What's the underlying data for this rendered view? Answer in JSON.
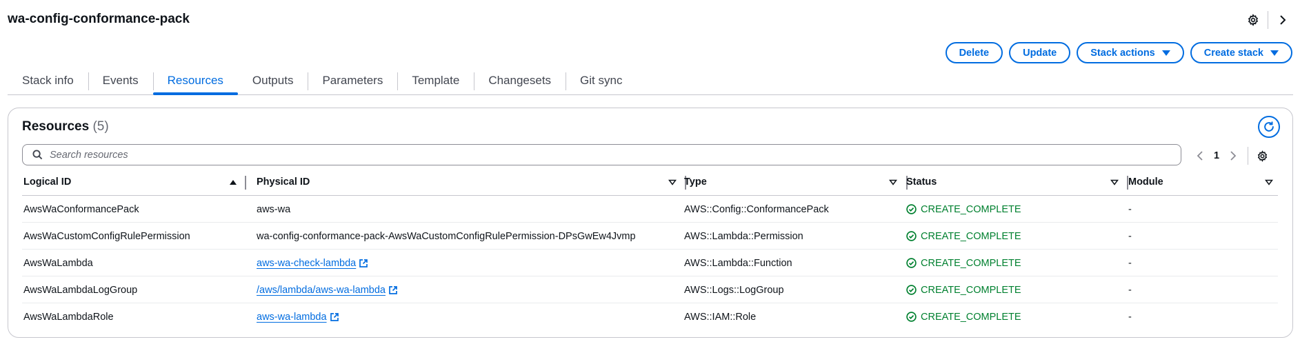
{
  "page": {
    "title": "wa-config-conformance-pack"
  },
  "top_icons": [
    "gear-icon",
    "chevron-right-icon"
  ],
  "actions": {
    "delete_label": "Delete",
    "update_label": "Update",
    "stack_actions_label": "Stack actions",
    "create_stack_label": "Create stack"
  },
  "tabs": [
    {
      "label": "Stack info"
    },
    {
      "label": "Events"
    },
    {
      "label": "Resources",
      "active": true
    },
    {
      "label": "Outputs"
    },
    {
      "label": "Parameters"
    },
    {
      "label": "Template"
    },
    {
      "label": "Changesets"
    },
    {
      "label": "Git sync"
    }
  ],
  "resources": {
    "title": "Resources",
    "count": "(5)",
    "search_placeholder": "Search resources",
    "page_number": "1",
    "columns": [
      "Logical ID",
      "Physical ID",
      "Type",
      "Status",
      "Module"
    ],
    "rows": [
      {
        "logical_id": "AwsWaConformancePack",
        "physical_id": "aws-wa",
        "physical_link": false,
        "type": "AWS::Config::ConformancePack",
        "status": "CREATE_COMPLETE",
        "module": "-"
      },
      {
        "logical_id": "AwsWaCustomConfigRulePermission",
        "physical_id": "wa-config-conformance-pack-AwsWaCustomConfigRulePermission-DPsGwEw4Jvmp",
        "physical_link": false,
        "type": "AWS::Lambda::Permission",
        "status": "CREATE_COMPLETE",
        "module": "-"
      },
      {
        "logical_id": "AwsWaLambda",
        "physical_id": "aws-wa-check-lambda",
        "physical_link": true,
        "type": "AWS::Lambda::Function",
        "status": "CREATE_COMPLETE",
        "module": "-"
      },
      {
        "logical_id": "AwsWaLambdaLogGroup",
        "physical_id": "/aws/lambda/aws-wa-lambda",
        "physical_link": true,
        "type": "AWS::Logs::LogGroup",
        "status": "CREATE_COMPLETE",
        "module": "-"
      },
      {
        "logical_id": "AwsWaLambdaRole",
        "physical_id": "aws-wa-lambda",
        "physical_link": true,
        "type": "AWS::IAM::Role",
        "status": "CREATE_COMPLETE",
        "module": "-"
      }
    ]
  },
  "colors": {
    "accent": "#006ce0",
    "success": "#00802f",
    "text": "#0f141a",
    "border": "#c6c6cd"
  }
}
